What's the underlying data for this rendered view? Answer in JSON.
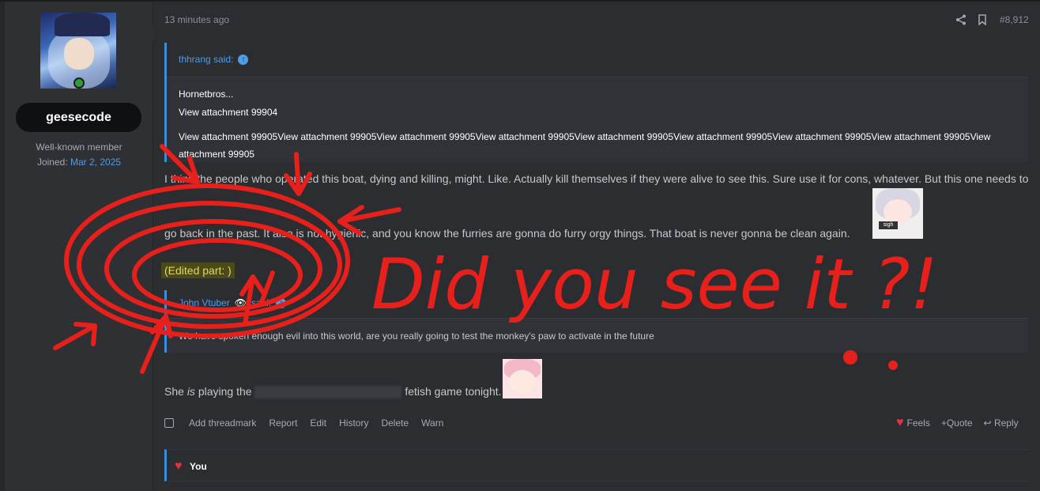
{
  "user": {
    "username": "geesecode",
    "title": "Well-known member",
    "joined_label": "Joined:",
    "joined_date": "Mar 2, 2025"
  },
  "post": {
    "timestamp": "13 minutes ago",
    "number": "#8,912",
    "quote1": {
      "author": "thhrang said:",
      "line1": "Hornetbros...",
      "line2": "View attachment 99904",
      "line3": "View attachment 99905View attachment 99905View attachment 99905View attachment 99905View attachment 99905View attachment 99905View attachment 99905View attachment 99905View attachment 99905"
    },
    "text1": "I think the people who operated this boat, dying and killing, might. Like. Actually kill themselves if they were alive to see this. Sure use it for cons, whatever. But this one needs to",
    "text2": "go back in the past. It also is not hygienic, and you know the furries are gonna do furry orgy things. That boat is never gonna be clean again.",
    "edited": "(Edited part: )",
    "quote2": {
      "author": "John Vtuber",
      "said": "said:",
      "line": "We have spoken enough evil into this world, are you really going to test the monkey's paw to activate in the future"
    },
    "text3_a": "She ",
    "text3_em": "is",
    "text3_b": " playing the",
    "text3_c": " fetish game tonight."
  },
  "actions": {
    "add_threadmark": "Add threadmark",
    "report": "Report",
    "edit": "Edit",
    "history": "History",
    "delete": "Delete",
    "warn": "Warn",
    "feels": "Feels",
    "quote": "+Quote",
    "reply": "Reply"
  },
  "reactions": {
    "label": "You"
  },
  "sticker1_tag": "sigh",
  "annotation": {
    "text": "Did you see it ?!",
    "color": "#e8201c"
  },
  "icons": [
    "share-icon",
    "bookmark-icon",
    "arrow-up-circle-icon",
    "eye-icon",
    "heart-icon",
    "reply-arrow-icon"
  ]
}
